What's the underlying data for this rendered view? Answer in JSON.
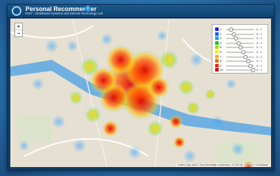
{
  "app": {
    "title": "Personal Recommender",
    "subtitle": "DSIT - Distributed Systems and Internet Technology Lab",
    "info": "i"
  },
  "map": {
    "zoom_in": "+",
    "zoom_out": "−",
    "attribution": "Leaflet | Map data © OpenStreetMap contributors, CC-BY-SA, Imagery © CloudMade"
  },
  "legend": {
    "rows": [
      {
        "color": "#1a1aff",
        "label": "1",
        "range": "0 - 1"
      },
      {
        "color": "#0060ff",
        "label": "2",
        "range": "0 - 1"
      },
      {
        "color": "#00a0ff",
        "label": "3",
        "range": "0 - 1"
      },
      {
        "color": "#00d000",
        "label": "4",
        "range": "0 - 1"
      },
      {
        "color": "#a0e000",
        "label": "5",
        "range": "0 - 1"
      },
      {
        "color": "#ffee00",
        "label": "6",
        "range": "0 - 1"
      },
      {
        "color": "#ffaa00",
        "label": "7",
        "range": "0 - 1"
      },
      {
        "color": "#ff6600",
        "label": "8",
        "range": "0 - 1"
      },
      {
        "color": "#ff2200",
        "label": "9",
        "range": "0 - 1"
      },
      {
        "color": "#cc0000",
        "label": "10",
        "range": "0 - 1"
      }
    ]
  }
}
